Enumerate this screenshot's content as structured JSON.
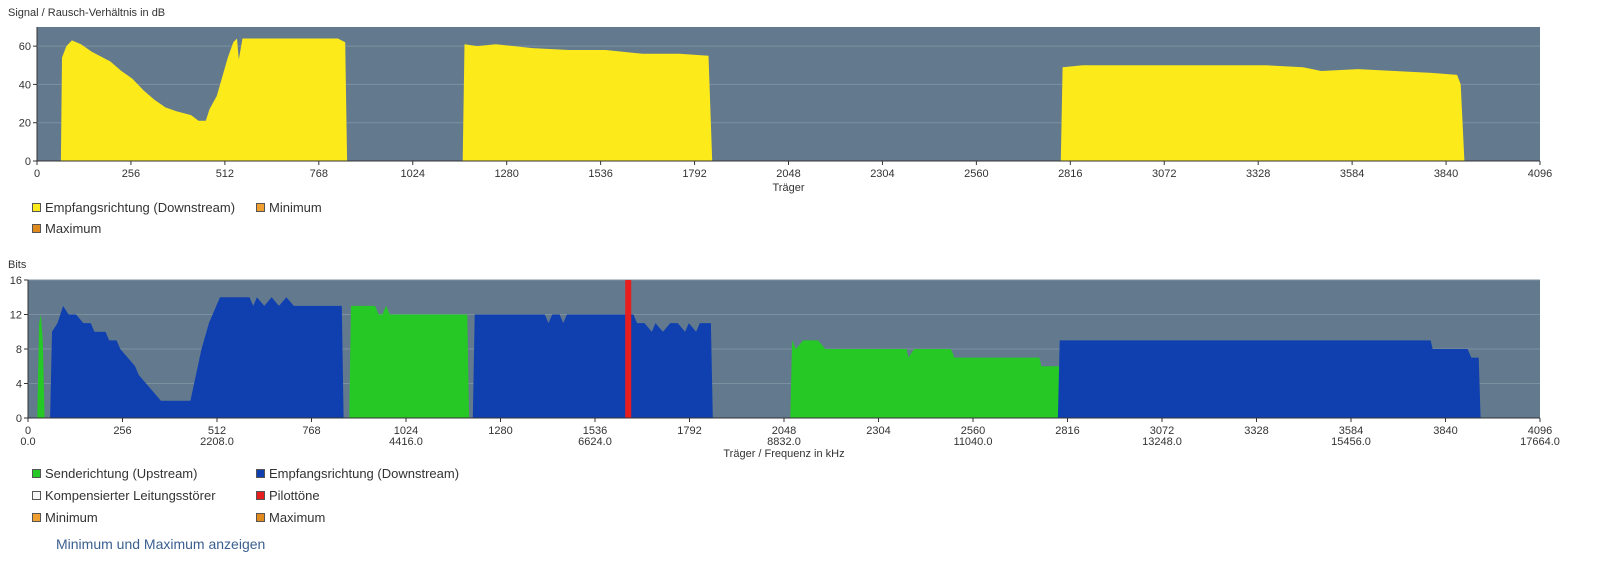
{
  "chart_data": [
    {
      "type": "area",
      "title": "Signal / Rausch-Verhältnis in dB",
      "xlabel": "Träger",
      "xlim": [
        0,
        4096
      ],
      "ylim": [
        0,
        70
      ],
      "xticks": [
        0,
        256,
        512,
        768,
        1024,
        1280,
        1536,
        1792,
        2048,
        2304,
        2560,
        2816,
        3072,
        3328,
        3584,
        3840,
        4096
      ],
      "yticks": [
        0,
        20,
        40,
        60
      ],
      "grid": true,
      "legend_position": "bottom-left",
      "colors": {
        "background": "#637a8e",
        "grid": "#7d90a0",
        "downstream": "#fdea1a"
      },
      "series": [
        {
          "name": "Empfangsrichtung (Downstream)",
          "color": "#fdea1a",
          "points": [
            [
              65,
              0
            ],
            [
              68,
              54
            ],
            [
              80,
              60
            ],
            [
              95,
              63
            ],
            [
              120,
              61
            ],
            [
              150,
              57
            ],
            [
              180,
              54
            ],
            [
              200,
              52
            ],
            [
              230,
              47
            ],
            [
              260,
              43
            ],
            [
              290,
              37
            ],
            [
              320,
              32
            ],
            [
              350,
              28
            ],
            [
              380,
              26
            ],
            [
              420,
              24
            ],
            [
              440,
              21
            ],
            [
              460,
              21
            ],
            [
              470,
              27
            ],
            [
              490,
              34
            ],
            [
              505,
              44
            ],
            [
              520,
              54
            ],
            [
              535,
              62
            ],
            [
              545,
              64
            ],
            [
              550,
              53
            ],
            [
              560,
              64
            ],
            [
              600,
              64
            ],
            [
              700,
              64
            ],
            [
              820,
              64
            ],
            [
              840,
              62
            ],
            [
              845,
              0
            ],
            [
              1160,
              0
            ],
            [
              1165,
              61
            ],
            [
              1200,
              60
            ],
            [
              1250,
              61
            ],
            [
              1350,
              59
            ],
            [
              1450,
              58
            ],
            [
              1550,
              58
            ],
            [
              1650,
              56
            ],
            [
              1750,
              56
            ],
            [
              1830,
              55
            ],
            [
              1840,
              0
            ],
            [
              2790,
              0
            ],
            [
              2795,
              49
            ],
            [
              2850,
              50
            ],
            [
              2950,
              50
            ],
            [
              3050,
              50
            ],
            [
              3150,
              50
            ],
            [
              3250,
              50
            ],
            [
              3350,
              50
            ],
            [
              3450,
              49
            ],
            [
              3500,
              47
            ],
            [
              3600,
              48
            ],
            [
              3700,
              47
            ],
            [
              3800,
              46
            ],
            [
              3870,
              45
            ],
            [
              3880,
              40
            ],
            [
              3890,
              0
            ]
          ]
        },
        {
          "name": "Minimum",
          "color": "#f0a030",
          "points": []
        },
        {
          "name": "Maximum",
          "color": "#e08a1e",
          "points": []
        }
      ]
    },
    {
      "type": "area",
      "title": "Bits",
      "xlabel": "Träger / Frequenz in kHz",
      "xlim": [
        0,
        4096
      ],
      "ylim": [
        0,
        16
      ],
      "xticks": [
        0,
        256,
        512,
        768,
        1024,
        1280,
        1536,
        1792,
        2048,
        2304,
        2560,
        2816,
        3072,
        3328,
        3584,
        3840,
        4096
      ],
      "xticks_secondary": [
        {
          "at": 0,
          "label": "0.0"
        },
        {
          "at": 512,
          "label": "2208.0"
        },
        {
          "at": 1024,
          "label": "4416.0"
        },
        {
          "at": 1536,
          "label": "6624.0"
        },
        {
          "at": 2048,
          "label": "8832.0"
        },
        {
          "at": 2560,
          "label": "11040.0"
        },
        {
          "at": 3072,
          "label": "13248.0"
        },
        {
          "at": 3584,
          "label": "15456.0"
        },
        {
          "at": 4096,
          "label": "17664.0"
        }
      ],
      "yticks": [
        0,
        4,
        8,
        12,
        16
      ],
      "grid": true,
      "legend_position": "bottom-left",
      "colors": {
        "background": "#637a8e",
        "grid": "#7d90a0",
        "upstream": "#26c826",
        "downstream": "#1040b0",
        "pilot": "#e81e1e"
      },
      "series": [
        {
          "name": "Senderichtung (Upstream)",
          "color": "#26c826",
          "points": [
            [
              25,
              0
            ],
            [
              30,
              11
            ],
            [
              35,
              12
            ],
            [
              40,
              9
            ],
            [
              45,
              0
            ],
            [
              870,
              0
            ],
            [
              875,
              13
            ],
            [
              940,
              13
            ],
            [
              950,
              12
            ],
            [
              960,
              12
            ],
            [
              970,
              13
            ],
            [
              980,
              12
            ],
            [
              1190,
              12
            ],
            [
              1195,
              0
            ],
            [
              2065,
              0
            ],
            [
              2070,
              9
            ],
            [
              2080,
              8
            ],
            [
              2100,
              9
            ],
            [
              2140,
              9
            ],
            [
              2160,
              8
            ],
            [
              2380,
              8
            ],
            [
              2385,
              7
            ],
            [
              2400,
              8
            ],
            [
              2500,
              8
            ],
            [
              2510,
              7
            ],
            [
              2620,
              7
            ],
            [
              2740,
              7
            ],
            [
              2745,
              6
            ],
            [
              2880,
              6
            ],
            [
              2885,
              0
            ]
          ]
        },
        {
          "name": "Empfangsrichtung (Downstream)",
          "color": "#1040b0",
          "points": [
            [
              60,
              0
            ],
            [
              65,
              10
            ],
            [
              80,
              11
            ],
            [
              95,
              13
            ],
            [
              110,
              12
            ],
            [
              130,
              12
            ],
            [
              150,
              11
            ],
            [
              170,
              11
            ],
            [
              180,
              10
            ],
            [
              210,
              10
            ],
            [
              220,
              9
            ],
            [
              240,
              9
            ],
            [
              250,
              8
            ],
            [
              270,
              7
            ],
            [
              290,
              6
            ],
            [
              300,
              5
            ],
            [
              320,
              4
            ],
            [
              340,
              3
            ],
            [
              360,
              2
            ],
            [
              440,
              2
            ],
            [
              450,
              4
            ],
            [
              460,
              6
            ],
            [
              470,
              8
            ],
            [
              490,
              11
            ],
            [
              510,
              13
            ],
            [
              520,
              14
            ],
            [
              600,
              14
            ],
            [
              610,
              13
            ],
            [
              620,
              14
            ],
            [
              640,
              13
            ],
            [
              660,
              14
            ],
            [
              680,
              13
            ],
            [
              700,
              14
            ],
            [
              720,
              13
            ],
            [
              750,
              13
            ],
            [
              850,
              13
            ],
            [
              855,
              0
            ],
            [
              1205,
              0
            ],
            [
              1210,
              12
            ],
            [
              1400,
              12
            ],
            [
              1410,
              11
            ],
            [
              1420,
              12
            ],
            [
              1440,
              12
            ],
            [
              1450,
              11
            ],
            [
              1460,
              12
            ],
            [
              1640,
              12
            ],
            [
              1650,
              11
            ],
            [
              1670,
              11
            ],
            [
              1690,
              10
            ],
            [
              1700,
              11
            ],
            [
              1720,
              10
            ],
            [
              1740,
              11
            ],
            [
              1760,
              11
            ],
            [
              1780,
              10
            ],
            [
              1790,
              11
            ],
            [
              1810,
              10
            ],
            [
              1820,
              11
            ],
            [
              1850,
              11
            ],
            [
              1855,
              0
            ],
            [
              2790,
              0
            ],
            [
              2795,
              9
            ],
            [
              3800,
              9
            ],
            [
              3805,
              8
            ],
            [
              3900,
              8
            ],
            [
              3910,
              7
            ],
            [
              3930,
              7
            ],
            [
              3935,
              0
            ]
          ]
        },
        {
          "name": "Kompensierter Leitungsstörer",
          "color": "#f5f5f5",
          "points": []
        },
        {
          "name": "Pilottöne",
          "color": "#e81e1e",
          "carriers": [
            1626
          ]
        },
        {
          "name": "Minimum",
          "color": "#f0a030",
          "points": []
        },
        {
          "name": "Maximum",
          "color": "#e08a1e",
          "points": []
        }
      ]
    }
  ],
  "toggle_link": "Minimum und Maximum anzeigen"
}
